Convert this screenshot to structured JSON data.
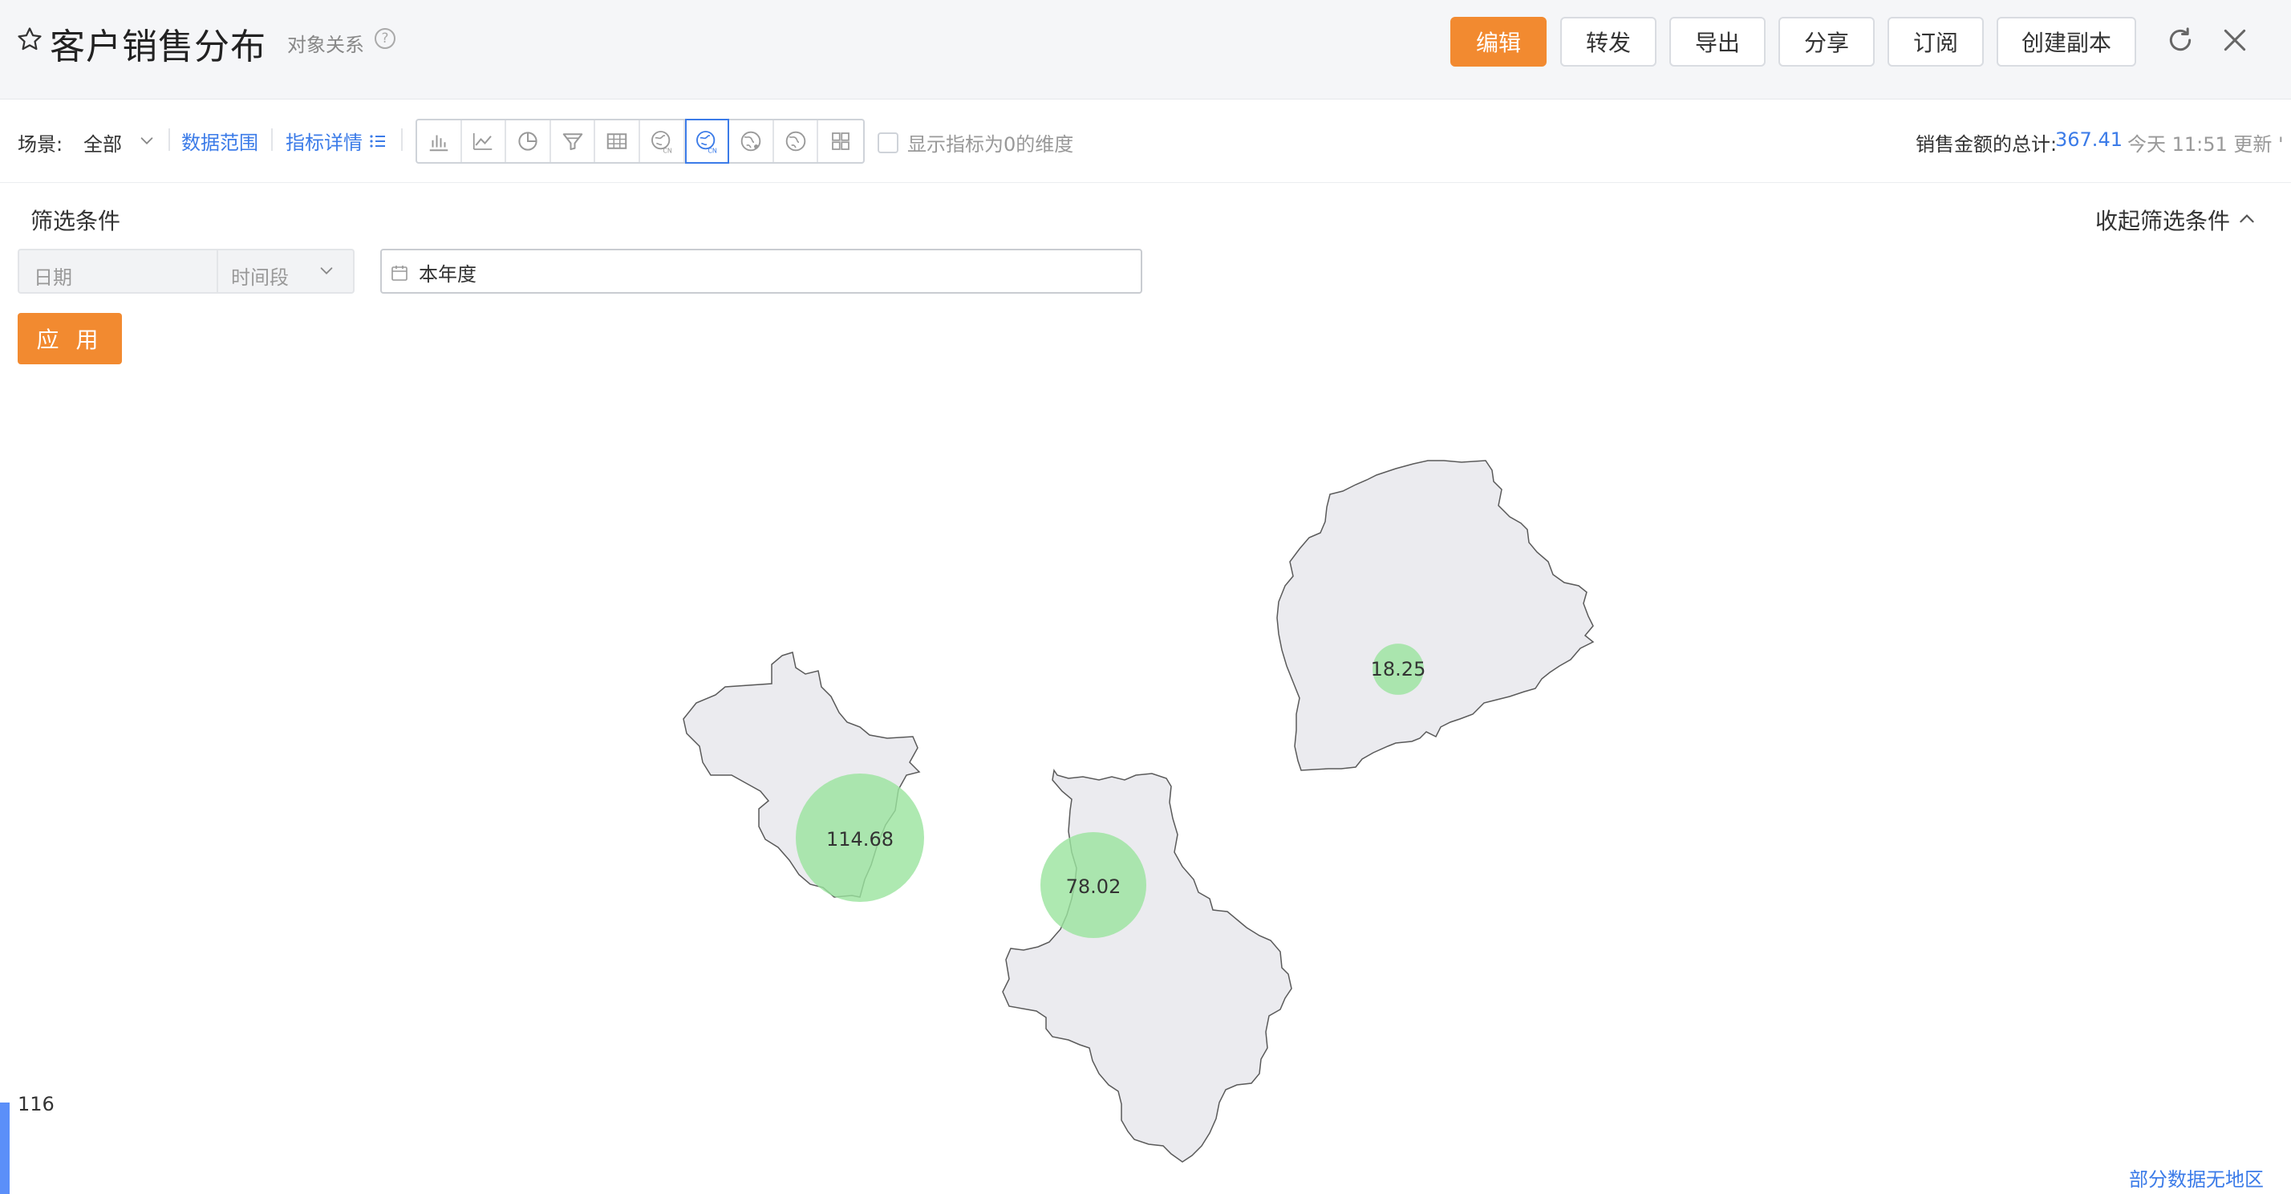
{
  "header": {
    "title": "客户销售分布",
    "subtitle": "对象关系",
    "help_symbol": "?",
    "buttons": {
      "edit": "编辑",
      "forward": "转发",
      "export": "导出",
      "share": "分享",
      "subscribe": "订阅",
      "copy": "创建副本"
    },
    "accent_color": "#f28a30"
  },
  "toolbar": {
    "scene_label": "场景:",
    "scene_value": "全部",
    "data_range": "数据范围",
    "metric_details": "指标详情",
    "chart_types": [
      "bar-chart",
      "line-chart",
      "pie-chart",
      "funnel-chart",
      "table",
      "china-map",
      "china-bubble-map",
      "world-map",
      "world-bubble-map",
      "dashboard-grid"
    ],
    "active_chart_type": "china-bubble-map",
    "show_zero_label": "显示指标为0的维度",
    "show_zero_checked": false,
    "total_label": "销售金额的总计:",
    "total_value": "367.41",
    "updated_text": "今天 11:51 更新 '"
  },
  "filter": {
    "title": "筛选条件",
    "collapse_label": "收起筛选条件",
    "date_placeholder": "日期",
    "period_placeholder": "时间段",
    "period_value": "本年度",
    "apply_label": "应 用"
  },
  "map": {
    "bubbles": [
      {
        "label": "114.68",
        "value": 114.68
      },
      {
        "label": "78.02",
        "value": 78.02
      },
      {
        "label": "18.25",
        "value": 18.25
      }
    ],
    "legend_max": "116",
    "no_region_note": "部分数据无地区",
    "region_fill": "#ebebef",
    "bubble_color": "#9ae39e"
  }
}
